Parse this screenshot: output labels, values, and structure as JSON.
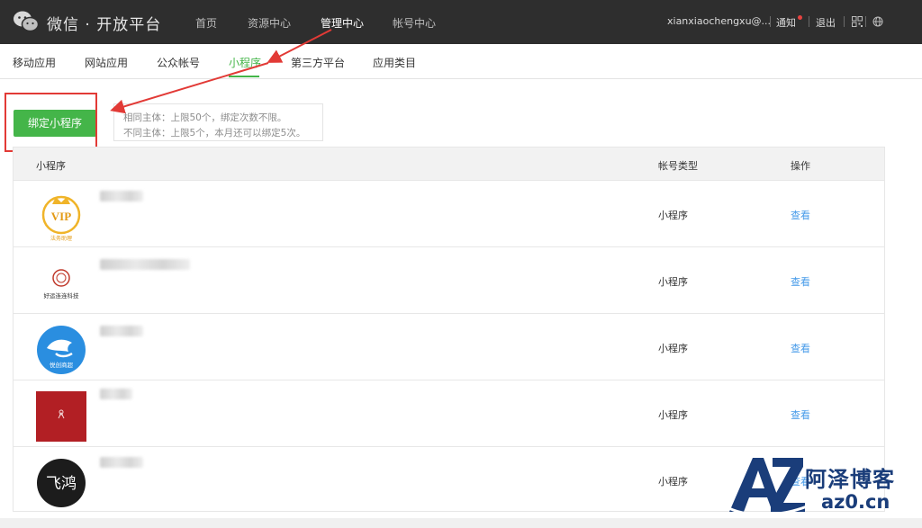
{
  "header": {
    "brand": "微信 · 开放平台",
    "nav": [
      "首页",
      "资源中心",
      "管理中心",
      "帐号中心"
    ],
    "active_nav": "管理中心",
    "account": "xianxiaochengxu@...",
    "notice": "通知",
    "logout": "退出",
    "icons": [
      "wechat-logo-icon",
      "qrcode-icon",
      "globe-icon"
    ]
  },
  "tabs": [
    "移动应用",
    "网站应用",
    "公众帐号",
    "小程序",
    "第三方平台",
    "应用类目"
  ],
  "active_tab": "小程序",
  "bind_button": "绑定小程序",
  "tip": {
    "line1": "相同主体：上限50个，绑定次数不限。",
    "line2": "不同主体：上限5个，本月还可以绑定5次。"
  },
  "table": {
    "columns": [
      "小程序",
      "帐号类型",
      "操作"
    ],
    "rows": [
      {
        "avatar_text": "VIP",
        "avatar_caption": "法务助理",
        "type": "小程序",
        "action": "查看"
      },
      {
        "avatar_text": "",
        "avatar_caption": "好运连连科技",
        "type": "小程序",
        "action": "查看"
      },
      {
        "avatar_text": "",
        "avatar_caption": "悦创商超",
        "type": "小程序",
        "action": "查看"
      },
      {
        "avatar_text": "",
        "avatar_caption": "",
        "type": "小程序",
        "action": "查看"
      },
      {
        "avatar_text": "飞鸿",
        "avatar_caption": "",
        "type": "小程序",
        "action": "查看"
      }
    ]
  },
  "watermark": {
    "cn": "阿泽博客",
    "url": "az0.cn",
    "mark": "AZ"
  },
  "colors": {
    "accent": "#44b549",
    "link": "#459ae9",
    "annotation": "#e23a36",
    "header_bg": "#2e2e2e"
  }
}
